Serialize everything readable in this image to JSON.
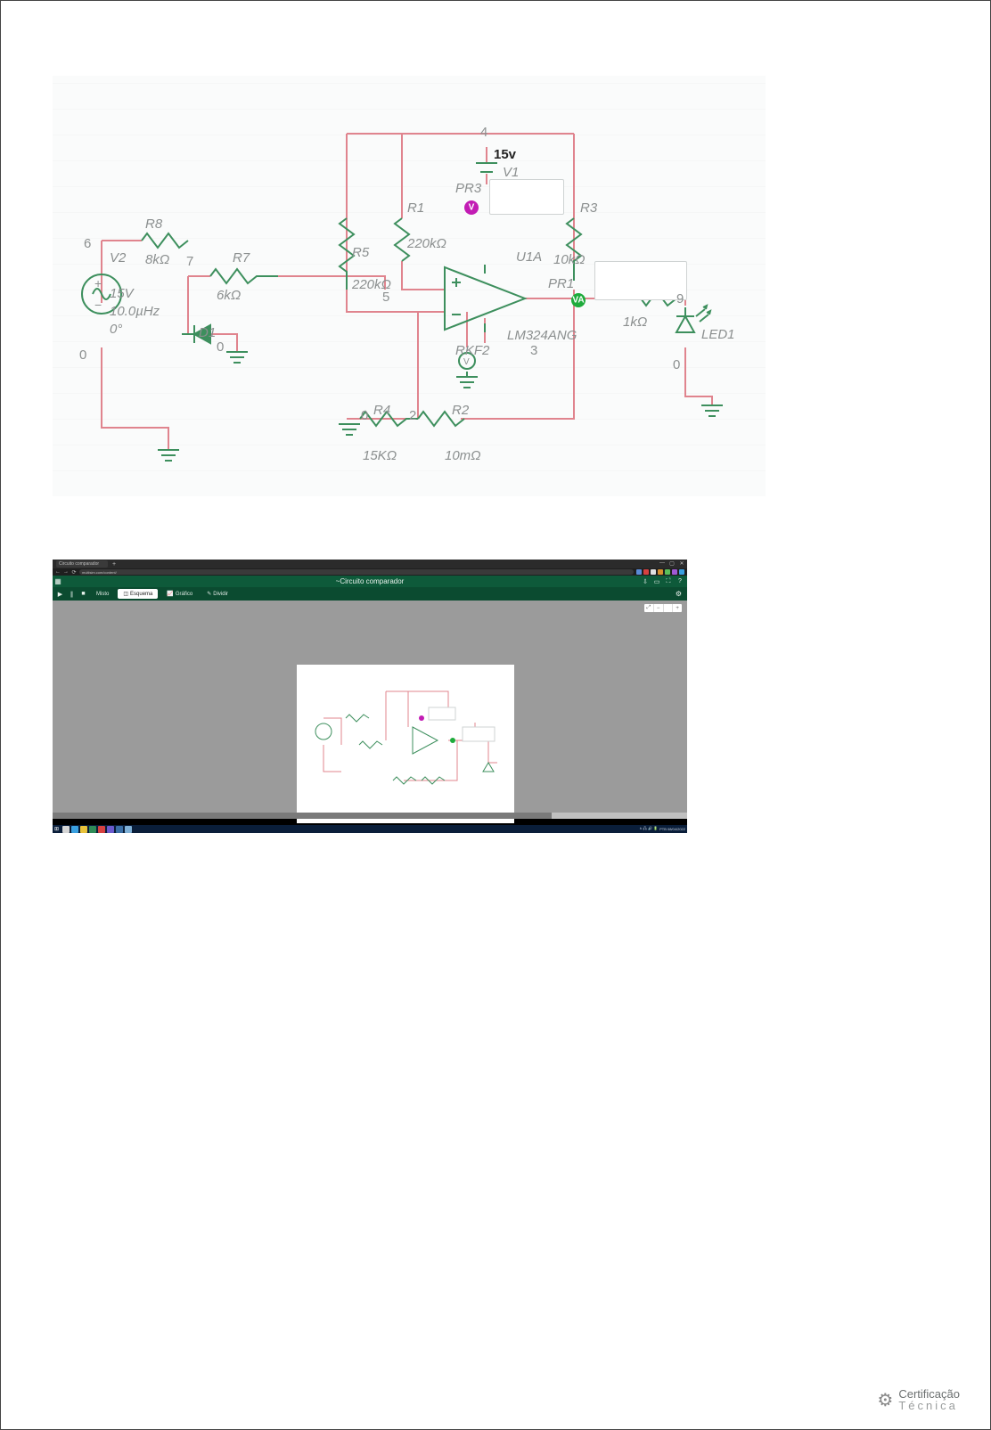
{
  "schematic": {
    "nodes": {
      "n0": "0",
      "n2": "2",
      "n3": "3",
      "n4": "4",
      "n5": "5",
      "n6": "6",
      "n7": "7",
      "n9": "9"
    },
    "voltage_label": "15v",
    "V1": {
      "ref": "V1"
    },
    "V2": {
      "ref": "V2",
      "v": "15V",
      "f": "10.0µHz",
      "ph": "0°"
    },
    "R1": {
      "ref": "R1",
      "val": "220kΩ"
    },
    "R2": {
      "ref": "R2",
      "val": "10mΩ"
    },
    "R3": {
      "ref": "R3",
      "val": "10kΩ"
    },
    "R4": {
      "ref": "R4",
      "val": "15KΩ"
    },
    "R5": {
      "ref": "R5",
      "val": "220kΩ"
    },
    "R6": {
      "ref": "RKF2"
    },
    "R7": {
      "ref": "R7",
      "val": "6kΩ"
    },
    "R8": {
      "ref": "R8",
      "val": "8kΩ"
    },
    "R9": {
      "val": "1kΩ"
    },
    "D1": {
      "ref": "D1"
    },
    "LED1": {
      "ref": "LED1"
    },
    "U1": {
      "ref": "U1A",
      "part": "LM324ANG"
    },
    "PR1": {
      "ref": "PR1"
    },
    "PR3": {
      "ref": "PR3"
    }
  },
  "browser": {
    "tab_title": "Circuito comparador",
    "url": "multisim.com/content/",
    "nav": {
      "back": "←",
      "fwd": "→",
      "reload": "⟳"
    },
    "window_controls": {
      "min": "—",
      "max": "▢",
      "close": "✕"
    },
    "ext_colors": [
      "#5a8bd6",
      "#d64141",
      "#e0e0e0",
      "#d68f2e",
      "#5abf5a",
      "#a05ad6",
      "#3aa0e0"
    ],
    "app": {
      "title": "~Circuito comparador",
      "menu_icon": "▦",
      "right_icons": [
        "⇩",
        "▭",
        "⛶",
        "?"
      ],
      "toolbar": {
        "play": "▶",
        "pause": "∥",
        "stop": "■",
        "tab_mixt": "Misto",
        "tab_schem": "Esquema",
        "tab_graph": "Gráfico",
        "tab_split": "Dividir",
        "gear": "⚙"
      },
      "zoom": {
        "fit": "⤢",
        "out": "−",
        "pct": "",
        "in": "+"
      }
    },
    "taskbar": {
      "start": "⊞",
      "icons_colors": [
        "#d6d6d6",
        "#3aa0e0",
        "#e8c23a",
        "#2e8b57",
        "#d64141",
        "#6a5acd",
        "#3a6ea5",
        "#7fb0d6"
      ],
      "tray_text": "PTB  08/04/2022",
      "tray_icons": [
        "∧",
        "🖧",
        "🔊",
        "🔋"
      ]
    }
  },
  "footer": {
    "line1": "Certificação",
    "line2": "Técnica"
  }
}
